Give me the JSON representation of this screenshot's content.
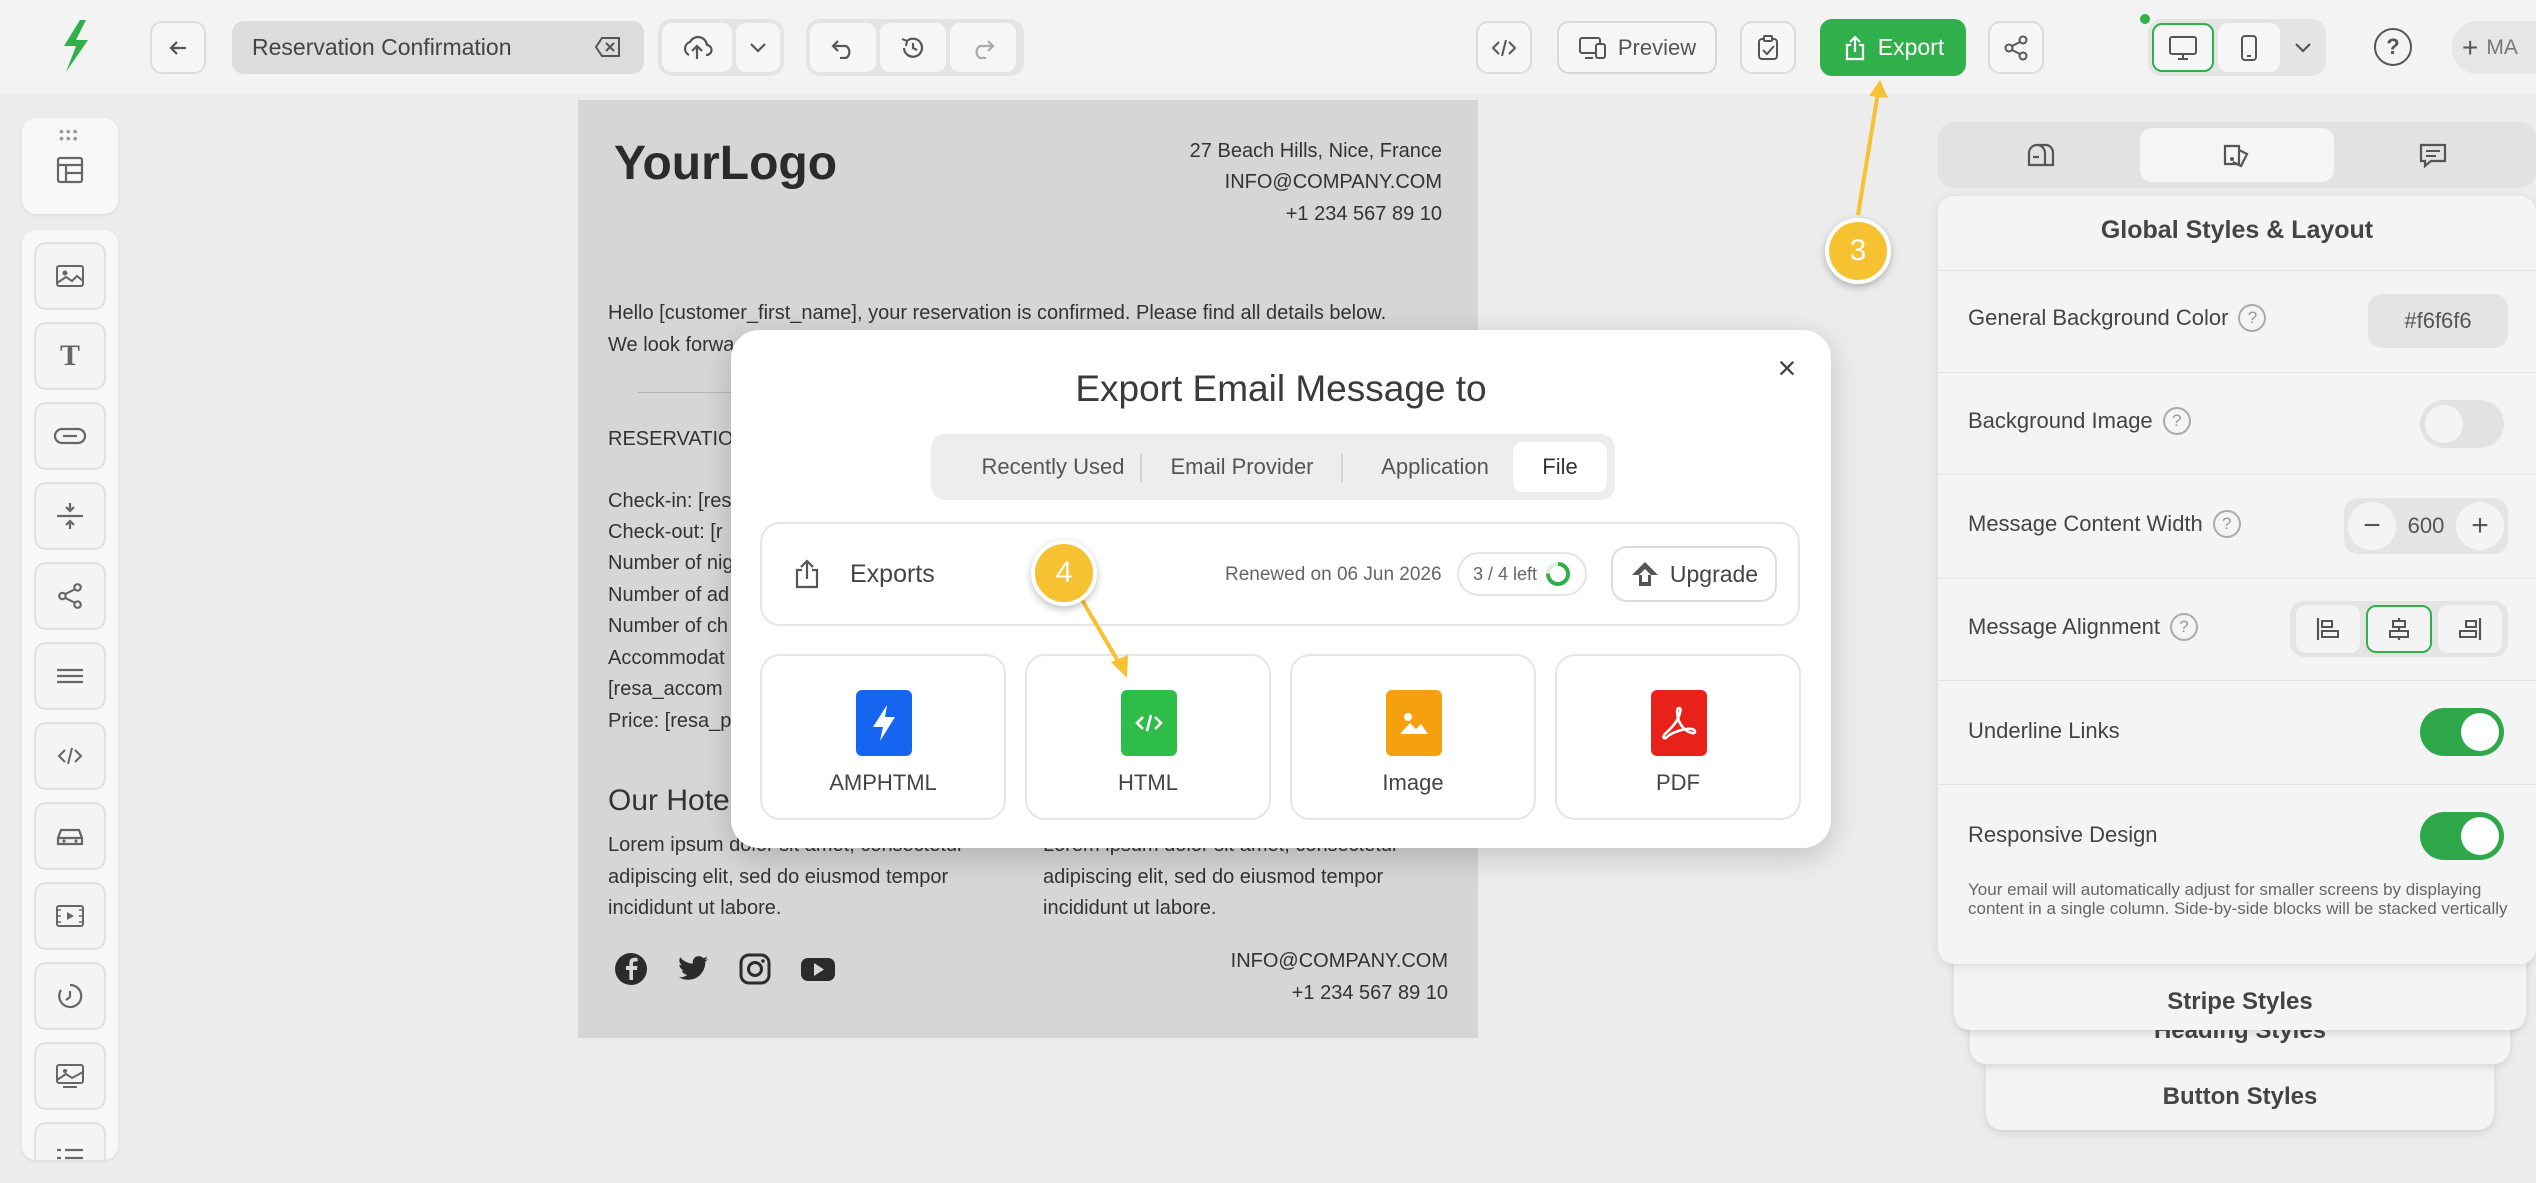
{
  "topbar": {
    "title_value": "Reservation Confirmation",
    "preview_label": "Preview",
    "export_label": "Export",
    "user_initials": "MA"
  },
  "email": {
    "logo": "YourLogo",
    "address": "27 Beach Hills, Nice, France",
    "email": "INFO@COMPANY.COM",
    "phone": "+1 234 567 89 10",
    "greeting_line1": "Hello [customer_first_name], your reservation is confirmed. Please find all details below.",
    "greeting_line2": "We look forwa",
    "section_title": "RESERVATIO",
    "details": [
      "Check-in: [res",
      "Check-out: [r",
      "Number of nig",
      "Number of ad",
      "Number of ch",
      "Accommodat",
      "[resa_accom",
      "Price: [resa_p"
    ],
    "hotel_heading": "Our Hote",
    "lorem_left_1": "Lorem ipsum dolor sit amet, consectetur",
    "lorem_left_2": "adipiscing elit, sed do eiusmod tempor",
    "lorem_left_3": "incididunt ut labore.",
    "lorem_right_1": "Lorem ipsum dolor sit amet, consectetur",
    "lorem_right_2": "adipiscing elit, sed do eiusmod tempor",
    "lorem_right_3": "incididunt ut labore.",
    "footer_email": "INFO@COMPANY.COM",
    "footer_phone": "+1 234 567 89 10"
  },
  "modal": {
    "title": "Export Email Message to",
    "tabs": [
      "Recently Used",
      "Email Provider",
      "Application",
      "File"
    ],
    "active_tab": "File",
    "exports_label": "Exports",
    "renewed_text": "Renewed on 06 Jun 2026",
    "quota_text": "3 / 4 left",
    "upgrade_label": "Upgrade",
    "options": [
      {
        "label": "AMPHTML",
        "color": "#1565f0",
        "icon": "lightning-icon"
      },
      {
        "label": "HTML",
        "color": "#2fbd4a",
        "icon": "code-file-icon"
      },
      {
        "label": "Image",
        "color": "#f5a00e",
        "icon": "image-file-icon"
      },
      {
        "label": "PDF",
        "color": "#e8221b",
        "icon": "pdf-icon"
      }
    ]
  },
  "right_panel": {
    "title": "Global Styles & Layout",
    "rows": {
      "bg_color_label": "General Background Color",
      "bg_color_value": "#f6f6f6",
      "bg_image_label": "Background Image",
      "width_label": "Message Content Width",
      "width_value": "600",
      "alignment_label": "Message Alignment",
      "underline_label": "Underline Links",
      "responsive_label": "Responsive Design",
      "responsive_note": "Your email will automatically adjust for smaller screens by displaying content in a single column. Side-by-side blocks will be stacked vertically"
    },
    "stacked": [
      "Stripe Styles",
      "Heading Styles",
      "Button Styles"
    ]
  },
  "callouts": [
    "3",
    "4"
  ],
  "colors": {
    "accent_green": "#2fb04b",
    "callout_yellow": "#f6c232"
  }
}
